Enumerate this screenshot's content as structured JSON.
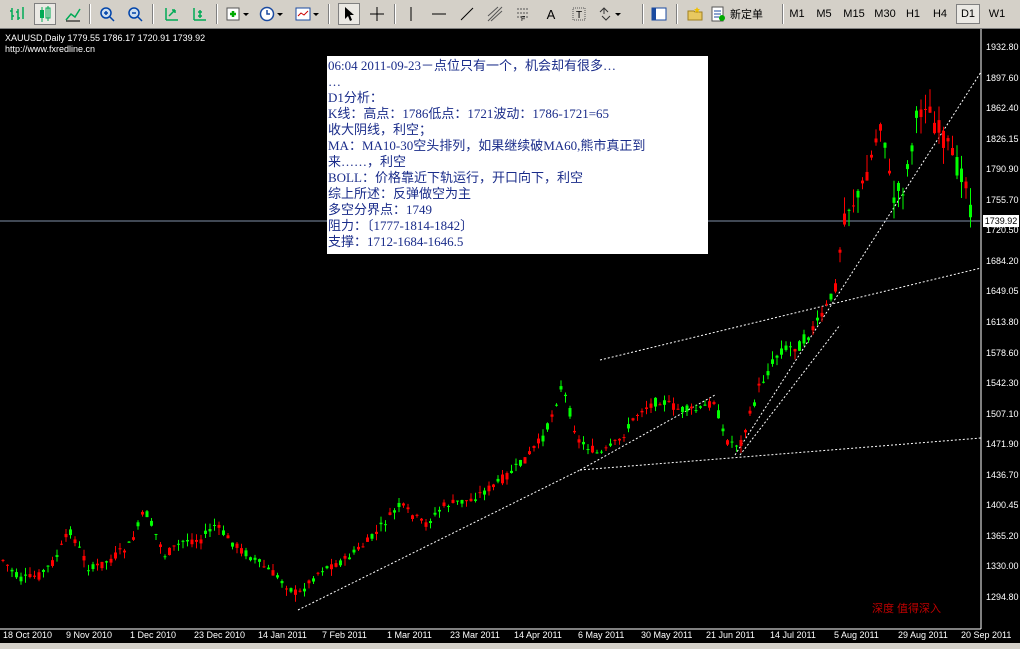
{
  "toolbar": {
    "new_order_label": "新定单",
    "timeframes": [
      "M1",
      "M5",
      "M15",
      "M30",
      "H1",
      "H4",
      "D1",
      "W1"
    ],
    "active_timeframe": "D1"
  },
  "chart": {
    "symbol_line": "XAUUSD,Daily  1779.55 1786.17 1720.91 1739.92",
    "website": "http://www.fxredline.cn",
    "current_price": "1739.92",
    "watermark": "深度   值得深入",
    "price_axis": [
      "1932.80",
      "1897.60",
      "1862.40",
      "1826.15",
      "1790.90",
      "1755.70",
      "1720.50",
      "1684.20",
      "1649.05",
      "1613.80",
      "1578.60",
      "1542.30",
      "1507.10",
      "1471.90",
      "1436.70",
      "1400.45",
      "1365.20",
      "1330.00",
      "1294.80"
    ],
    "date_axis": [
      "18 Oct 2010",
      "9 Nov 2010",
      "1 Dec 2010",
      "23 Dec 2010",
      "14 Jan 2011",
      "7 Feb 2011",
      "1 Mar 2011",
      "23 Mar 2011",
      "14 Apr 2011",
      "6 May 2011",
      "30 May 2011",
      "21 Jun 2011",
      "14 Jul 2011",
      "5 Aug 2011",
      "29 Aug 2011",
      "20 Sep 2011"
    ],
    "colors": {
      "bull": "#00ff00",
      "bear": "#ff0000",
      "background": "#000000",
      "note_text": "#1a2c8a"
    }
  },
  "note": {
    "lines": [
      "06:04 2011-09-23－点位只有一个，机会却有很多…",
      "…",
      "D1分析：",
      "K线：高点：1786低点：1721波动：1786-1721=65",
      "收大阴线，利空；",
      "MA：MA10-30空头排列，如果继续破MA60,熊市真正到",
      "来……，利空",
      "BOLL：价格靠近下轨运行，开口向下，利空",
      "综上所述：反弹做空为主",
      "多空分界点：1749",
      "阻力：〔1777-1814-1842〕",
      "支撑：1712-1684-1646.5"
    ]
  }
}
